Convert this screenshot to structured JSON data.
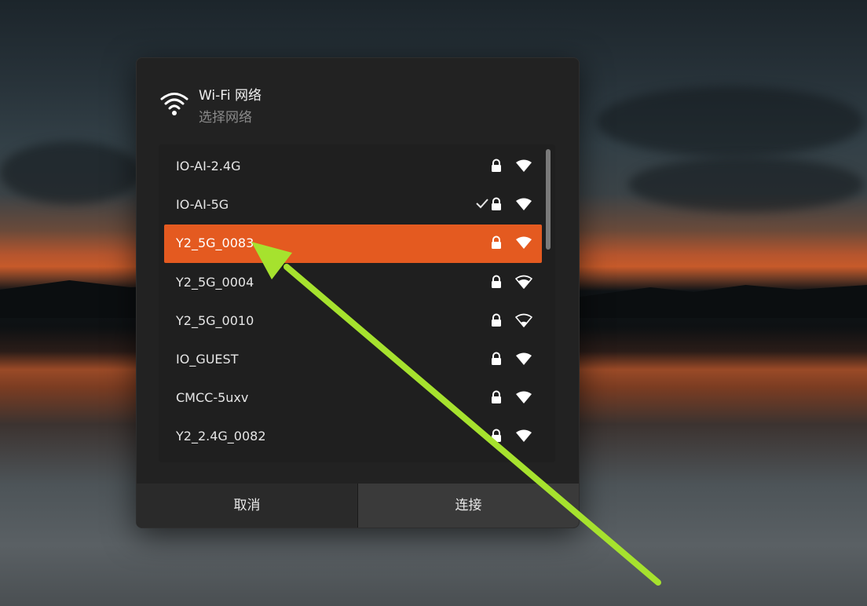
{
  "dialog": {
    "title": "Wi-Fi 网络",
    "subtitle": "选择网络",
    "header_icon": "wifi-icon"
  },
  "networks": [
    {
      "name": "IO-AI-2.4G",
      "secured": true,
      "connected": false,
      "signal": "full",
      "selected": false
    },
    {
      "name": "IO-AI-5G",
      "secured": true,
      "connected": true,
      "signal": "full",
      "selected": false
    },
    {
      "name": "Y2_5G_0083",
      "secured": true,
      "connected": false,
      "signal": "full",
      "selected": true
    },
    {
      "name": "Y2_5G_0004",
      "secured": true,
      "connected": false,
      "signal": "medium",
      "selected": false
    },
    {
      "name": "Y2_5G_0010",
      "secured": true,
      "connected": false,
      "signal": "low",
      "selected": false
    },
    {
      "name": "IO_GUEST",
      "secured": true,
      "connected": false,
      "signal": "full",
      "selected": false
    },
    {
      "name": "CMCC-5uxv",
      "secured": true,
      "connected": false,
      "signal": "full",
      "selected": false
    },
    {
      "name": "Y2_2.4G_0082",
      "secured": true,
      "connected": false,
      "signal": "full",
      "selected": false
    }
  ],
  "buttons": {
    "cancel_label": "取消",
    "connect_label": "连接"
  },
  "colors": {
    "accent": "#e45a20",
    "annotation_arrow": "#a6e22e"
  }
}
